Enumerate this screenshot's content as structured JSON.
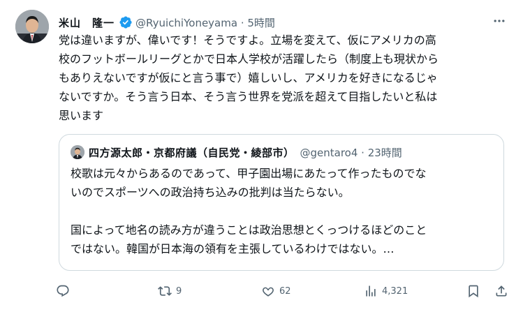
{
  "tweet": {
    "author_name": "米山　隆一",
    "handle_time": "@RyuichiYoneyama · 5時間",
    "text": "党は違いますが、偉いです！そうですよ。立場を変えて、仮にアメリカの高\n校のフットボールリーグとかで日本人学校が活躍したら（制度上も現状から\nもありえないですが仮にと言う事で）嬉しいし、アメリカを好きになるじゃ\nないですか。そう言う日本、そう言う世界を党派を超えて目指したいと私は\n思います"
  },
  "quote": {
    "author_name": "四方源太郎・京都府議（自民党・綾部市）",
    "handle_time": "@gentaro4 · 23時間",
    "text": "校歌は元々からあるのであって、甲子園出場にあたって作ったものでな\nいのでスポーツへの政治持ち込みの批判は当たらない。\n\n国によって地名の読み方が違うことは政治思想とくっつけるほどのこと\nではない。韓国が日本海の領有を主張しているわけではない。…"
  },
  "actions": {
    "reply_count": "",
    "retweet_count": "9",
    "like_count": "62",
    "view_count": "4,321"
  },
  "colors": {
    "verified": "#1d9bf0",
    "muted": "#536471",
    "border": "#cfd9de"
  },
  "icons": [
    "more-icon",
    "verified-badge-icon",
    "reply-icon",
    "retweet-icon",
    "like-icon",
    "views-icon",
    "bookmark-icon",
    "share-icon"
  ]
}
